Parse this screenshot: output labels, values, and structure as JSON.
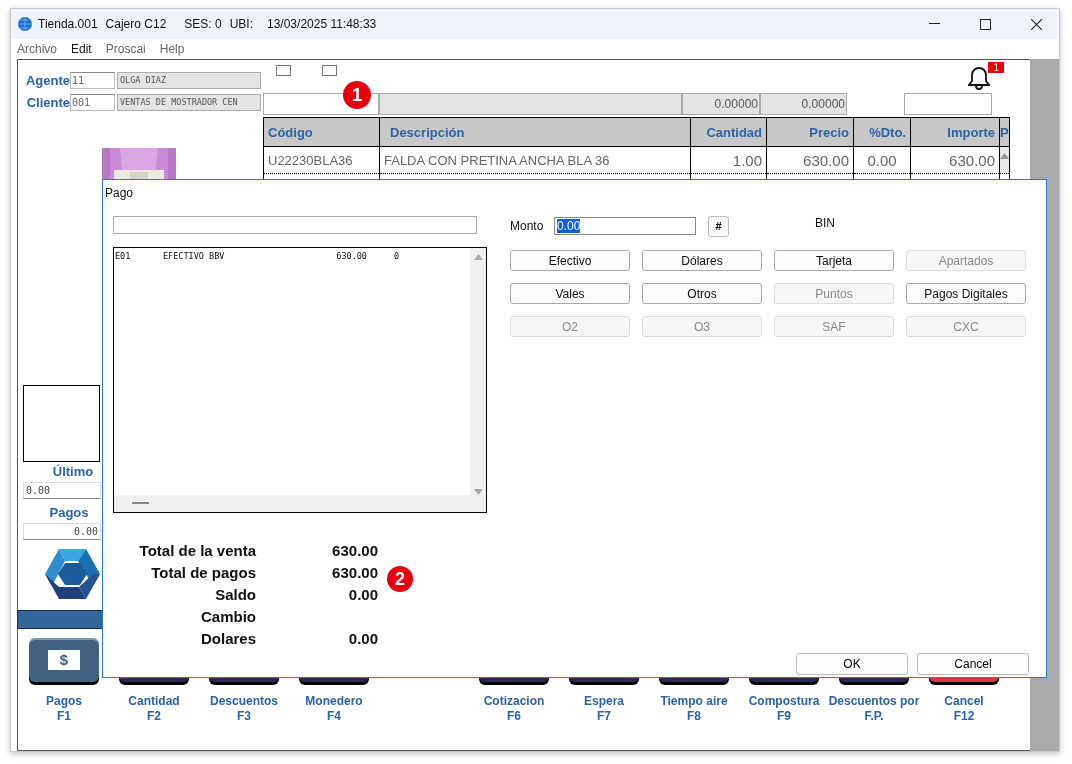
{
  "window": {
    "title_parts": [
      "Tienda.001",
      "Cajero C12",
      "SES: 0",
      "UBI:",
      "13/03/2025 11:48:33"
    ]
  },
  "menu": [
    {
      "label": "Archivo",
      "disabled": true
    },
    {
      "label": "Edit",
      "disabled": false
    },
    {
      "label": "Proscai",
      "disabled": true
    },
    {
      "label": "Help",
      "disabled": true
    }
  ],
  "agent": {
    "label": "Agente",
    "code": "11",
    "name": "OLGA DIAZ"
  },
  "client": {
    "label": "Cliente",
    "code": "001",
    "name": "VENTAS DE MOSTRADOR CEN"
  },
  "checkboxes": [
    {
      "checked": false
    },
    {
      "checked": false
    }
  ],
  "notifications": {
    "count": "1"
  },
  "readouts": [
    "0.00000",
    "0.00000"
  ],
  "table": {
    "columns": [
      "Código",
      "Descripción",
      "Cantidad",
      "Precio",
      "%Dto.",
      "Importe",
      "P"
    ],
    "rows": [
      {
        "cells": [
          "U22230BLA36",
          "FALDA CON PRETINA ANCHA BLA 36",
          "1.00",
          "630.00",
          "0.00",
          "630.00"
        ]
      }
    ]
  },
  "left_panel": {
    "last_label": "Último",
    "last_value": "0.00",
    "payments_label": "Pagos",
    "payments_value": "0.00"
  },
  "function_keys": [
    {
      "label": "Pagos",
      "key": "F1",
      "symbol": "$",
      "color": "#3f6381"
    },
    {
      "label": "Cantidad",
      "key": "F2",
      "color": "#1d2f52"
    },
    {
      "label": "Descuentos",
      "key": "F3",
      "color": "#1d2f52"
    },
    {
      "label": "Monedero",
      "key": "F4",
      "color": "#1d2f52"
    },
    {
      "label": "Cotizacion",
      "key": "F6",
      "color": "#1d2f52"
    },
    {
      "label": "Espera",
      "key": "F7",
      "color": "#1d2f52"
    },
    {
      "label": "Tiempo aire",
      "key": "F8",
      "color": "#1d2f52"
    },
    {
      "label": "Compostura",
      "key": "F9",
      "color": "#1d2f52"
    },
    {
      "label": "Descuentos por",
      "key": "F.P.",
      "color": "#1d2f52"
    },
    {
      "label": "Cancel",
      "key": "F12",
      "color": "#d23a3f"
    }
  ],
  "dialog": {
    "title": "Pago",
    "entries": [
      {
        "code": "E01",
        "name": "EFECTIVO BBV",
        "amount": "630.00",
        "extra": "0"
      }
    ],
    "amount": {
      "label": "Monto",
      "value": "0.00",
      "highlighted": true
    },
    "hash_button": "#",
    "bin_label": "BIN",
    "buttons": [
      {
        "label": "Efectivo",
        "disabled": false
      },
      {
        "label": "Dólares",
        "disabled": false
      },
      {
        "label": "Tarjeta",
        "disabled": false
      },
      {
        "label": "Apartados",
        "disabled": true
      },
      {
        "label": "Vales",
        "disabled": false
      },
      {
        "label": "Otros",
        "disabled": false
      },
      {
        "label": "Puntos",
        "disabled": true
      },
      {
        "label": "Pagos Digitales",
        "disabled": false
      },
      {
        "label": "O2",
        "disabled": true
      },
      {
        "label": "O3",
        "disabled": true
      },
      {
        "label": "SAF",
        "disabled": true
      },
      {
        "label": "CXC",
        "disabled": true
      }
    ],
    "totals": [
      {
        "label": "Total de la venta",
        "value": "630.00"
      },
      {
        "label": "Total de pagos",
        "value": "630.00"
      },
      {
        "label": "Saldo",
        "value": "0.00"
      },
      {
        "label": "Cambio"
      },
      {
        "label": "Dolares",
        "value": "0.00"
      }
    ],
    "footer_buttons": [
      "OK",
      "Cancel"
    ]
  },
  "markers": [
    "1",
    "2"
  ]
}
